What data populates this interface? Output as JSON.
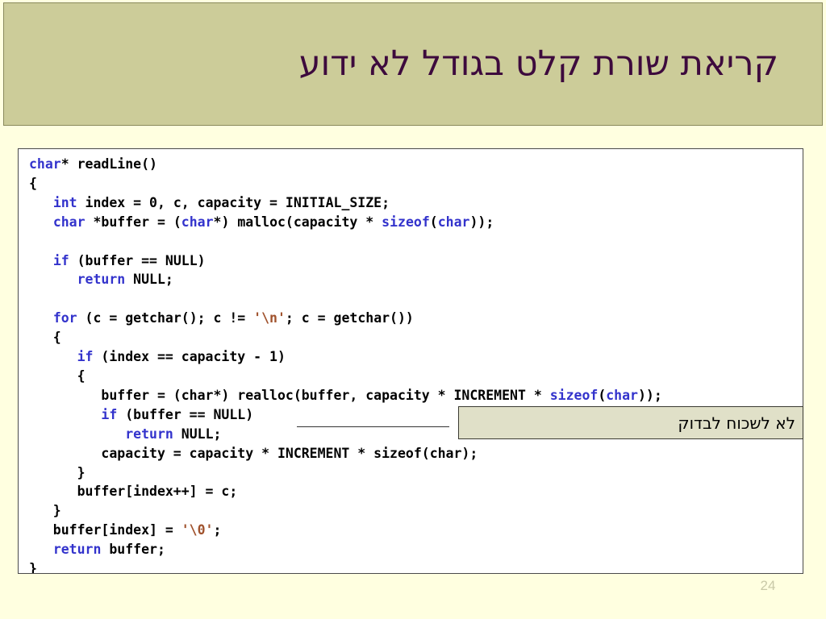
{
  "slide": {
    "title": "קריאת שורת קלט בגודל לא ידוע",
    "number": "24",
    "colors": {
      "page_background": "#FFFFE0",
      "header_background": "#CCCC99",
      "title_text": "#3D0A3D",
      "code_background": "#FFFFFF",
      "keyword": "#3333CC",
      "string_literal": "#A0522D",
      "callout_background": "#E0E0C8"
    }
  },
  "code": {
    "language": "c",
    "lines": [
      [
        {
          "t": "char",
          "c": "kw"
        },
        {
          "t": "* readLine()",
          "c": ""
        }
      ],
      [
        {
          "t": "{",
          "c": ""
        }
      ],
      [
        {
          "t": "   ",
          "c": ""
        },
        {
          "t": "int",
          "c": "kw"
        },
        {
          "t": " index = 0, c, capacity = INITIAL_SIZE;",
          "c": ""
        }
      ],
      [
        {
          "t": "   ",
          "c": ""
        },
        {
          "t": "char",
          "c": "kw"
        },
        {
          "t": " *buffer = (",
          "c": ""
        },
        {
          "t": "char",
          "c": "kw"
        },
        {
          "t": "*) malloc(capacity * ",
          "c": ""
        },
        {
          "t": "sizeof",
          "c": "kw"
        },
        {
          "t": "(",
          "c": ""
        },
        {
          "t": "char",
          "c": "kw"
        },
        {
          "t": "));",
          "c": ""
        }
      ],
      [
        {
          "t": "",
          "c": ""
        }
      ],
      [
        {
          "t": "   ",
          "c": ""
        },
        {
          "t": "if",
          "c": "kw"
        },
        {
          "t": " (buffer == NULL)",
          "c": ""
        }
      ],
      [
        {
          "t": "      ",
          "c": ""
        },
        {
          "t": "return",
          "c": "kw"
        },
        {
          "t": " NULL;",
          "c": ""
        }
      ],
      [
        {
          "t": "",
          "c": ""
        }
      ],
      [
        {
          "t": "   ",
          "c": ""
        },
        {
          "t": "for",
          "c": "kw"
        },
        {
          "t": " (c = getchar(); c != ",
          "c": ""
        },
        {
          "t": "'\\n'",
          "c": "str"
        },
        {
          "t": "; c = getchar())",
          "c": ""
        }
      ],
      [
        {
          "t": "   {",
          "c": ""
        }
      ],
      [
        {
          "t": "      ",
          "c": ""
        },
        {
          "t": "if",
          "c": "kw"
        },
        {
          "t": " (index == capacity - 1)",
          "c": ""
        }
      ],
      [
        {
          "t": "      {",
          "c": ""
        }
      ],
      [
        {
          "t": "         buffer = (char*) realloc(buffer, capacity * INCREMENT * ",
          "c": ""
        },
        {
          "t": "sizeof",
          "c": "kw"
        },
        {
          "t": "(",
          "c": ""
        },
        {
          "t": "char",
          "c": "kw"
        },
        {
          "t": "));",
          "c": ""
        }
      ],
      [
        {
          "t": "         ",
          "c": ""
        },
        {
          "t": "if",
          "c": "kw"
        },
        {
          "t": " (buffer == NULL)",
          "c": ""
        }
      ],
      [
        {
          "t": "            ",
          "c": ""
        },
        {
          "t": "return",
          "c": "kw"
        },
        {
          "t": " NULL;",
          "c": ""
        }
      ],
      [
        {
          "t": "         capacity = capacity * INCREMENT * sizeof(char);",
          "c": ""
        }
      ],
      [
        {
          "t": "      }",
          "c": ""
        }
      ],
      [
        {
          "t": "      buffer[index++] = c;",
          "c": ""
        }
      ],
      [
        {
          "t": "   }",
          "c": ""
        }
      ],
      [
        {
          "t": "   buffer[index] = ",
          "c": ""
        },
        {
          "t": "'\\0'",
          "c": "str"
        },
        {
          "t": ";",
          "c": ""
        }
      ],
      [
        {
          "t": "   ",
          "c": ""
        },
        {
          "t": "return",
          "c": "kw"
        },
        {
          "t": " buffer;",
          "c": ""
        }
      ],
      [
        {
          "t": "}",
          "c": ""
        }
      ]
    ]
  },
  "callout": {
    "text": "לא לשכוח לבדוק"
  }
}
